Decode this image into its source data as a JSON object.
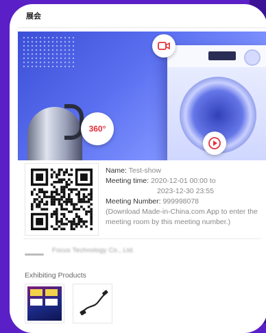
{
  "header": {
    "title": "展会"
  },
  "banner": {
    "badge_360": "360°",
    "camera_icon": "camera-icon",
    "play_icon": "play-icon"
  },
  "meeting": {
    "name_label": "Name:",
    "name_value": "Test-show",
    "time_label": "Meeting time:",
    "time_start": "2020-12-01 00:00 to",
    "time_end": "2023-12-30 23:55",
    "number_label": "Meeting Number:",
    "number_value": "999998078",
    "note": "(Download Made-in-China.com App to enter the meeting room by this meeting number.)"
  },
  "company": {
    "name": "Focus Technology Co., Ltd."
  },
  "products": {
    "label": "Exhibiting Products"
  },
  "colors": {
    "accent_purple": "#5b1fc7",
    "play_red": "#e3303b"
  }
}
